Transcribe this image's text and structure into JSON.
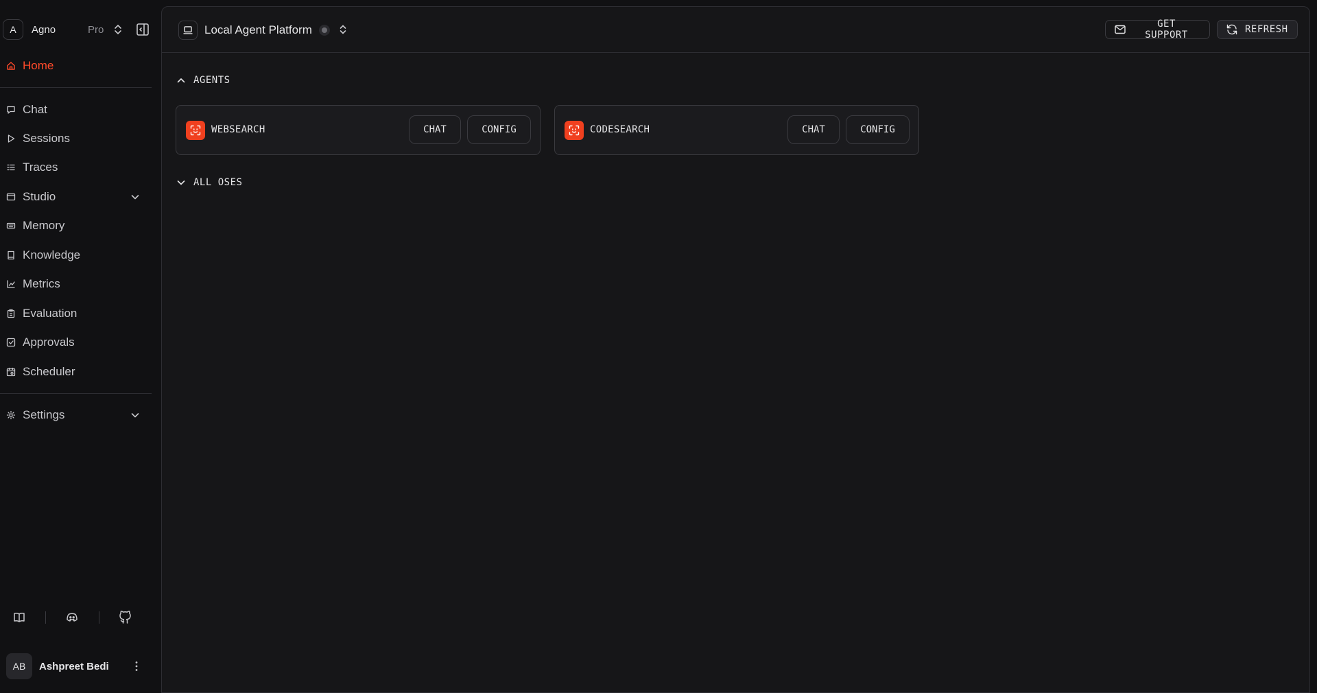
{
  "workspace": {
    "avatar_letter": "A",
    "name": "Agno",
    "plan": "Pro"
  },
  "sidebar": {
    "home": "Home",
    "items": [
      {
        "label": "Chat",
        "icon": "chat-bubble-icon"
      },
      {
        "label": "Sessions",
        "icon": "play-icon"
      },
      {
        "label": "Traces",
        "icon": "list-icon"
      },
      {
        "label": "Studio",
        "icon": "window-icon"
      },
      {
        "label": "Memory",
        "icon": "keyboard-icon"
      },
      {
        "label": "Knowledge",
        "icon": "book-icon"
      },
      {
        "label": "Metrics",
        "icon": "line-chart-icon"
      },
      {
        "label": "Evaluation",
        "icon": "clipboard-icon"
      },
      {
        "label": "Approvals",
        "icon": "checkbox-icon"
      },
      {
        "label": "Scheduler",
        "icon": "calendar-icon"
      }
    ],
    "settings": "Settings"
  },
  "user": {
    "initials": "AB",
    "name": "Ashpreet Bedi"
  },
  "topbar": {
    "platform_name": "Local Agent Platform",
    "support_label": "GET SUPPORT",
    "refresh_label": "REFRESH"
  },
  "sections": {
    "agents_label": "AGENTS",
    "all_oses_label": "ALL OSES"
  },
  "agents": [
    {
      "name": "WEBSEARCH",
      "chat_label": "CHAT",
      "config_label": "CONFIG"
    },
    {
      "name": "CODESEARCH",
      "chat_label": "CHAT",
      "config_label": "CONFIG"
    }
  ],
  "colors": {
    "accent": "#ff4a2a",
    "agent_icon_bg": "#f0401f",
    "background": "#111113",
    "panel": "#161618",
    "border": "#2d2d32"
  }
}
